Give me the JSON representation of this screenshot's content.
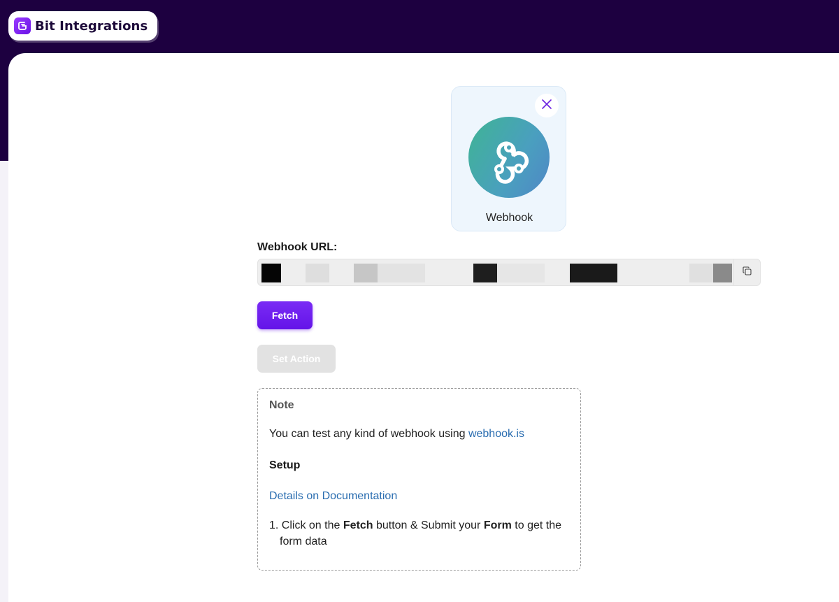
{
  "brand": {
    "name": "Bit Integrations",
    "logo_letter": "G"
  },
  "app_card": {
    "name": "Webhook",
    "close_icon": "close-icon",
    "logo_icon": "webhook-icon"
  },
  "webhook": {
    "label": "Webhook URL:",
    "copy_icon": "copy-icon"
  },
  "buttons": {
    "fetch": "Fetch",
    "set_action": "Set Action"
  },
  "note": {
    "title": "Note",
    "text_prefix": "You can test any kind of webhook using ",
    "link_text": "webhook.is",
    "setup_title": "Setup",
    "doc_link": "Details on Documentation",
    "step": {
      "number": "1.",
      "part1": "Click on the ",
      "bold1": "Fetch",
      "part2": " button & Submit your ",
      "bold2": "Form",
      "part3": " to get the form data"
    }
  },
  "colors": {
    "header_bg": "#1d0040",
    "accent": "#6414e8",
    "link": "#2a6db0"
  }
}
